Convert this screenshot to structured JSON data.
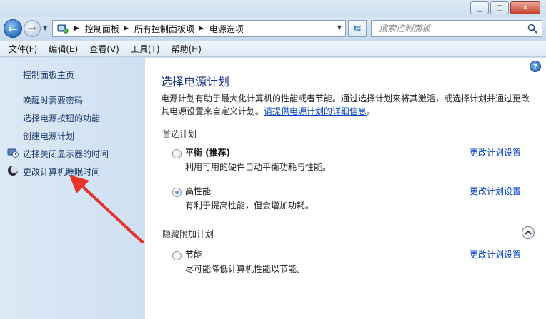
{
  "window": {
    "minimize_glyph": "▁",
    "maximize_glyph": "▢",
    "close_glyph": "✕"
  },
  "address_bar": {
    "icon": "control-panel-icon",
    "crumbs": [
      "控制面板",
      "所有控制面板项",
      "电源选项"
    ]
  },
  "search": {
    "placeholder": "搜索控制面板"
  },
  "menu": {
    "items": [
      "文件(F)",
      "编辑(E)",
      "查看(V)",
      "工具(T)",
      "帮助(H)"
    ]
  },
  "sidebar": {
    "home": "控制面板主页",
    "links": [
      "唤醒时需要密码",
      "选择电源按钮的功能",
      "创建电源计划",
      "选择关闭显示器的时间",
      "更改计算机睡眠时间"
    ]
  },
  "main": {
    "title": "选择电源计划",
    "description": "电源计划有助于最大化计算机的性能或者节能。通过选择计划来将其激活，或选择计划并通过更改其电源设置来自定义计划。",
    "more_info_link": "请提供电源计划的详细信息",
    "description_end": "。",
    "preferred_label": "首选计划",
    "hidden_label": "隐藏附加计划",
    "plans": [
      {
        "name": "平衡 (推荐)",
        "desc": "利用可用的硬件自动平衡功耗与性能。",
        "link": "更改计划设置",
        "selected": false
      },
      {
        "name": "高性能",
        "desc": "有利于提高性能，但会增加功耗。",
        "link": "更改计划设置",
        "selected": true
      },
      {
        "name": "节能",
        "desc": "尽可能降低计算机性能以节能。",
        "link": "更改计划设置",
        "selected": false
      }
    ]
  },
  "colors": {
    "accent": "#1e3287",
    "link": "#0645c8",
    "annotation": "#e8322c"
  }
}
